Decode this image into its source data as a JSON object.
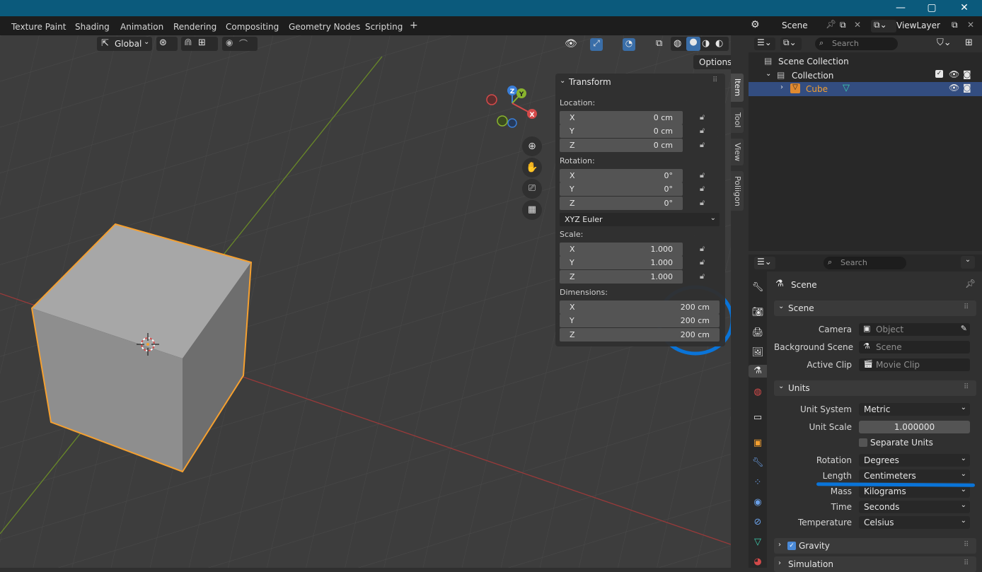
{
  "window": {
    "minimize_icon": "minimize-icon",
    "maximize_icon": "maximize-icon",
    "close_icon": "close-icon"
  },
  "workspaces": [
    "Texture Paint",
    "Shading",
    "Animation",
    "Rendering",
    "Compositing",
    "Geometry Nodes",
    "Scripting",
    "+"
  ],
  "toolbar": {
    "orientation": "Global"
  },
  "viewport": {
    "options_label": "Options",
    "gizmo": {
      "x": "X",
      "y": "Y",
      "z": "Z"
    }
  },
  "npanel": {
    "title": "Transform",
    "location_label": "Location:",
    "location": [
      {
        "axis": "X",
        "value": "0 cm"
      },
      {
        "axis": "Y",
        "value": "0 cm"
      },
      {
        "axis": "Z",
        "value": "0 cm"
      }
    ],
    "rotation_label": "Rotation:",
    "rotation": [
      {
        "axis": "X",
        "value": "0°"
      },
      {
        "axis": "Y",
        "value": "0°"
      },
      {
        "axis": "Z",
        "value": "0°"
      }
    ],
    "rotation_mode": "XYZ Euler",
    "scale_label": "Scale:",
    "scale": [
      {
        "axis": "X",
        "value": "1.000"
      },
      {
        "axis": "Y",
        "value": "1.000"
      },
      {
        "axis": "Z",
        "value": "1.000"
      }
    ],
    "dimensions_label": "Dimensions:",
    "dimensions": [
      {
        "axis": "X",
        "value": "200 cm"
      },
      {
        "axis": "Y",
        "value": "200 cm"
      },
      {
        "axis": "Z",
        "value": "200 cm"
      }
    ],
    "side_tabs": [
      "Item",
      "Tool",
      "View",
      "Poliigon"
    ]
  },
  "topbar_right": {
    "scene": "Scene",
    "view_layer": "ViewLayer"
  },
  "outliner": {
    "search_placeholder": "Search",
    "scene_collection": "Scene Collection",
    "collection": "Collection",
    "cube": "Cube"
  },
  "properties": {
    "search_placeholder": "Search",
    "context_title": "Scene",
    "scene_panel": {
      "title": "Scene",
      "camera_label": "Camera",
      "camera_value": "Object",
      "background_scene_label": "Background Scene",
      "background_scene_value": "Scene",
      "active_clip_label": "Active Clip",
      "active_clip_value": "Movie Clip"
    },
    "units_panel": {
      "title": "Units",
      "unit_system_label": "Unit System",
      "unit_system_value": "Metric",
      "unit_scale_label": "Unit Scale",
      "unit_scale_value": "1.000000",
      "separate_units_label": "Separate Units",
      "rotation_label": "Rotation",
      "rotation_value": "Degrees",
      "length_label": "Length",
      "length_value": "Centimeters",
      "mass_label": "Mass",
      "mass_value": "Kilograms",
      "time_label": "Time",
      "time_value": "Seconds",
      "temperature_label": "Temperature",
      "temperature_value": "Celsius"
    },
    "gravity_label": "Gravity",
    "simulation_label": "Simulation"
  },
  "colors": {
    "title_bar": "#0b5a7c",
    "selection_orange": "#f5a030",
    "annotation_blue": "#0a74d8",
    "x_axis": "#d44a4a",
    "y_axis": "#8ab42e",
    "z_axis": "#3a7ed8"
  }
}
